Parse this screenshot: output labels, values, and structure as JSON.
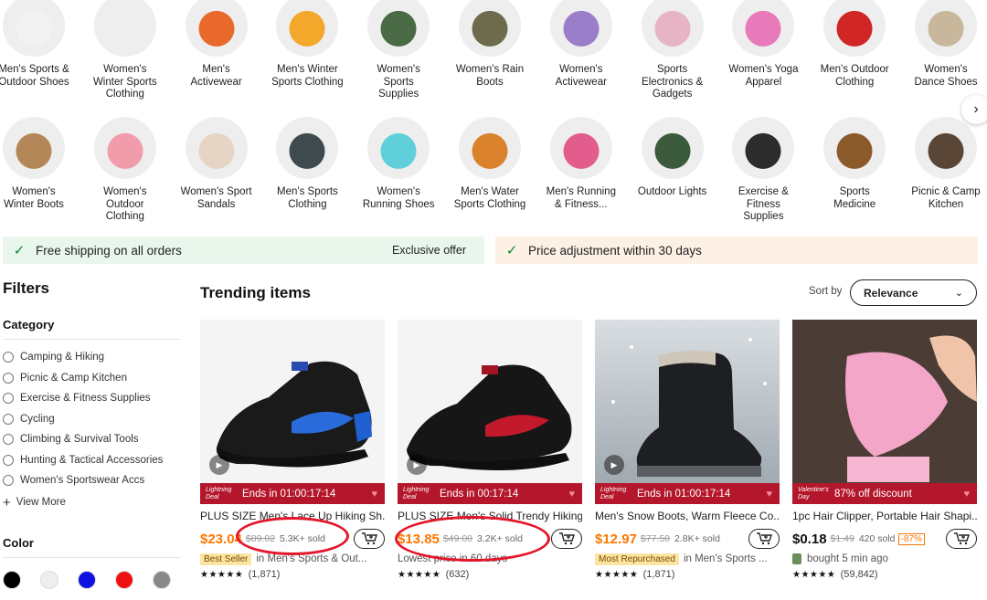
{
  "categories_row1": [
    {
      "label": "Men's Sports & Outdoor Shoes",
      "icon": "sneaker-icon",
      "color": "#f2f2f2"
    },
    {
      "label": "Women's Winter Sports Clothing",
      "icon": "jacket-icon",
      "color": "#eeeeee"
    },
    {
      "label": "Men's Activewear",
      "icon": "jacket-icon",
      "color": "#e9692d"
    },
    {
      "label": "Men's Winter Sports Clothing",
      "icon": "suit-icon",
      "color": "#f3a72b"
    },
    {
      "label": "Women's Sports Supplies",
      "icon": "knee-brace-icon",
      "color": "#4a6b45"
    },
    {
      "label": "Women's Rain Boots",
      "icon": "boot-icon",
      "color": "#6e6a4c"
    },
    {
      "label": "Women's Activewear",
      "icon": "dress-icon",
      "color": "#9b7ec9"
    },
    {
      "label": "Sports Electronics & Gadgets",
      "icon": "watch-icon",
      "color": "#e7b4c5"
    },
    {
      "label": "Women's Yoga Apparel",
      "icon": "yoga-top-icon",
      "color": "#e87ab9"
    },
    {
      "label": "Men's Outdoor Clothing",
      "icon": "jacket-icon",
      "color": "#d02626"
    },
    {
      "label": "Women's Dance Shoes",
      "icon": "shoe-icon",
      "color": "#c9b79c"
    }
  ],
  "categories_row2": [
    {
      "label": "Women's Winter Boots",
      "icon": "boot-icon",
      "color": "#b38758"
    },
    {
      "label": "Women's Outdoor Clothing",
      "icon": "jacket-icon",
      "color": "#f09cab"
    },
    {
      "label": "Women's Sport Sandals",
      "icon": "sandal-icon",
      "color": "#e6d5c4"
    },
    {
      "label": "Men's Sports Clothing",
      "icon": "hoodie-icon",
      "color": "#3f4a4f"
    },
    {
      "label": "Women's Running Shoes",
      "icon": "sneaker-icon",
      "color": "#5fd0d9"
    },
    {
      "label": "Men's Water Sports Clothing",
      "icon": "swimwear-icon",
      "color": "#d9822b"
    },
    {
      "label": "Men's Running & Fitness...",
      "icon": "runner-icon",
      "color": "#e25c8c"
    },
    {
      "label": "Outdoor Lights",
      "icon": "lantern-icon",
      "color": "#3b5b3c"
    },
    {
      "label": "Exercise & Fitness Supplies",
      "icon": "ball-icon",
      "color": "#2c2c2c"
    },
    {
      "label": "Sports Medicine",
      "icon": "wrist-brace-icon",
      "color": "#8b5a2b"
    },
    {
      "label": "Picnic & Camp Kitchen",
      "icon": "cookware-icon",
      "color": "#5a4636"
    }
  ],
  "banners": {
    "shipping": "Free shipping on all orders",
    "exclusive": "Exclusive offer",
    "price_adjust": "Price adjustment within 30 days"
  },
  "filters": {
    "title": "Filters",
    "category_title": "Category",
    "categories": [
      "Camping & Hiking",
      "Picnic & Camp Kitchen",
      "Exercise & Fitness Supplies",
      "Cycling",
      "Climbing & Survival Tools",
      "Hunting & Tactical Accessories",
      "Women's Sportswear Accs"
    ],
    "view_more": "View More",
    "color_title": "Color",
    "colors": [
      "#000000",
      "#eeeeee",
      "#1010e0",
      "#ee1111",
      "#888888",
      "#f7b7c8",
      "#118a1a",
      "#7a1a9a",
      "#f2ea1a",
      "#f2e7a0"
    ]
  },
  "trending": {
    "title": "Trending items",
    "sort_label": "Sort by",
    "sort_value": "Relevance"
  },
  "products": [
    {
      "deal_tag": "Lightning Deal",
      "deal_text": "Ends in 01:00:17:14",
      "title": "PLUS SIZE Men's Lace Up Hiking Sh...",
      "price": "$23.04",
      "old_price": "$89.02",
      "sold": "5.3K+ sold",
      "badge": "Best Seller",
      "sub": "in Men's Sports & Out...",
      "rating_count": "(1,871)"
    },
    {
      "deal_tag": "Lightning Deal",
      "deal_text": "Ends in 00:17:14",
      "title": "PLUS SIZE Men's Solid Trendy Hiking...",
      "price": "$13.85",
      "old_price": "$49.00",
      "sold": "3.2K+ sold",
      "badge": "",
      "sub": "Lowest price in 60 days",
      "rating_count": "(632)"
    },
    {
      "deal_tag": "Lightning Deal",
      "deal_text": "Ends in 01:00:17:14",
      "title": "Men's Snow Boots, Warm Fleece Co...",
      "price": "$12.97",
      "old_price": "$77.50",
      "sold": "2.8K+ sold",
      "badge": "Most Repurchased",
      "sub": "in Men's Sports ...",
      "rating_count": "(1,871)"
    },
    {
      "deal_tag": "Valentine's Day",
      "deal_text": "87% off discount",
      "title": "1pc Hair Clipper, Portable Hair Shapi...",
      "price": "$0.18",
      "old_price": "$1.49",
      "sold": "420 sold",
      "discount": "-87%",
      "badge": "",
      "sub": "bought 5 min ago",
      "rating_count": "(59,842)"
    }
  ]
}
